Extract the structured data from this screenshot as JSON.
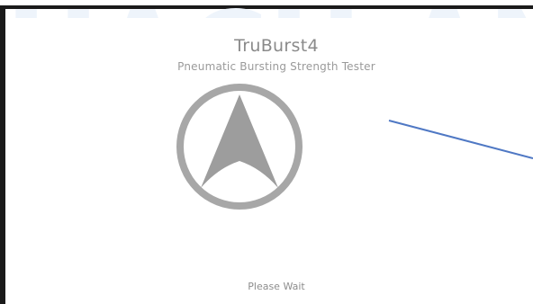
{
  "app": {
    "title": "TruBurst4",
    "subtitle": "Pneumatic Bursting Strength Tester",
    "status": "Please Wait"
  },
  "watermark": {
    "text": "HACH AN",
    "color": "#eef4fb"
  },
  "logo": {
    "icon": "truburst-logo-icon",
    "ring_color": "#a7a7a7",
    "arrow_color": "#9d9d9d"
  },
  "callout": {
    "color": "#4f78c4"
  }
}
